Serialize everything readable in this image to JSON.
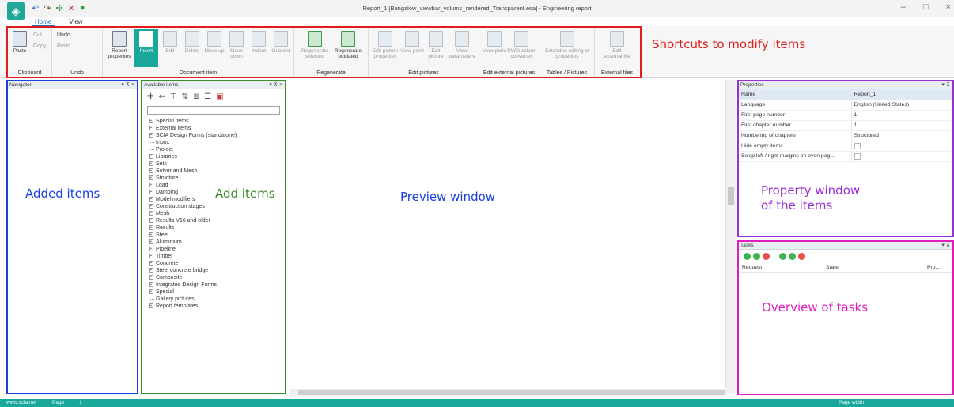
{
  "window": {
    "title": "Report_1 [Bungalow_viewbar_volums_rendered_Transparent.esa] - Engineering report",
    "minimize": "–",
    "maximize": "□",
    "close": "×"
  },
  "ribbon_tabs": [
    "Home",
    "View"
  ],
  "ribbon": {
    "clipboard": {
      "paste": "Paste",
      "cut": "Cut",
      "copy": "Copy",
      "label": "Clipboard"
    },
    "undo": {
      "undo": "Undo",
      "redo": "Redo",
      "label": "Undo"
    },
    "report": {
      "properties": "Report properties"
    },
    "document_item": {
      "insert": "Insert",
      "edit": "Edit",
      "delete": "Delete",
      "move_up": "Move up",
      "move_down": "Move down",
      "indent": "Indent",
      "outdent": "Outdent",
      "label": "Document item"
    },
    "regenerate": {
      "selected": "Regenerate selected",
      "outdated": "Regenerate outdated",
      "label": "Regenerate"
    },
    "edit_pictures": {
      "edit_picture_properties": "Edit picture properties",
      "view_point": "View point",
      "edit_picture": "Edit picture",
      "view_parameters": "View parameters",
      "label": "Edit pictures"
    },
    "edit_external": {
      "view_point": "View point",
      "dwg": "DWG colour converter",
      "label": "Edit external pictures"
    },
    "tables": {
      "extended": "Extended editing of properties",
      "label": "Tables / Pictures"
    },
    "external_files": {
      "edit": "Edit external file",
      "label": "External files"
    }
  },
  "annotations": {
    "shortcuts": "Shortcuts to modify items",
    "added_items": "Added items",
    "add_items": "Add items",
    "preview": "Preview window",
    "property_window": "Property window\nof the items",
    "tasks": "Overview of tasks"
  },
  "navigator": {
    "title": "Navigator"
  },
  "available_items": {
    "title": "Available items",
    "tree": [
      {
        "label": "Special items",
        "expandable": true
      },
      {
        "label": "External items",
        "expandable": true
      },
      {
        "label": "SCIA Design Forms (standalone)",
        "expandable": true
      },
      {
        "label": "Inbox",
        "expandable": false
      },
      {
        "label": "Project",
        "expandable": false
      },
      {
        "label": "Libraries",
        "expandable": true
      },
      {
        "label": "Sets",
        "expandable": true
      },
      {
        "label": "Solver and Mesh",
        "expandable": true
      },
      {
        "label": "Structure",
        "expandable": true
      },
      {
        "label": "Load",
        "expandable": true
      },
      {
        "label": "Damping",
        "expandable": true
      },
      {
        "label": "Model modifiers",
        "expandable": true
      },
      {
        "label": "Construction stages",
        "expandable": true
      },
      {
        "label": "Mesh",
        "expandable": true
      },
      {
        "label": "Results V16 and older",
        "expandable": true
      },
      {
        "label": "Results",
        "expandable": true
      },
      {
        "label": "Steel",
        "expandable": true
      },
      {
        "label": "Aluminium",
        "expandable": true
      },
      {
        "label": "Pipeline",
        "expandable": true
      },
      {
        "label": "Timber",
        "expandable": true
      },
      {
        "label": "Concrete",
        "expandable": true
      },
      {
        "label": "Steel concrete bridge",
        "expandable": true
      },
      {
        "label": "Composite",
        "expandable": true
      },
      {
        "label": "Integrated Design Forms",
        "expandable": true
      },
      {
        "label": "Special",
        "expandable": true
      },
      {
        "label": "Gallery pictures",
        "expandable": false
      },
      {
        "label": "Report templates",
        "expandable": true
      }
    ]
  },
  "properties": {
    "title": "Properties",
    "rows": [
      {
        "name": "Name",
        "value": "Report_1"
      },
      {
        "name": "Language",
        "value": "English (United States)"
      },
      {
        "name": "First page number",
        "value": "1"
      },
      {
        "name": "First chapter number",
        "value": "1"
      },
      {
        "name": "Numbering of chapters",
        "value": "Structured"
      },
      {
        "name": "Hide empty items",
        "value": ""
      },
      {
        "name": "Swap left / right margins on even pag...",
        "value": ""
      }
    ]
  },
  "tasks": {
    "title": "Tasks",
    "columns": [
      "Request",
      "State",
      "Pro..."
    ]
  },
  "statusbar": {
    "site": "www.scia.net",
    "page_label": "Page",
    "page": "1",
    "zoom": "Page width"
  },
  "colors": {
    "ribbon_border": "#e01c1c",
    "navigator_border": "#1c3fe0",
    "available_border": "#3d8b2a",
    "properties_border": "#9b2fd6",
    "tasks_border": "#e01cc0",
    "accent": "#1aa89b"
  }
}
